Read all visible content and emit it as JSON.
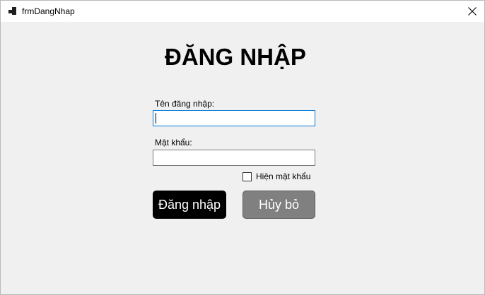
{
  "window": {
    "title": "frmDangNhap",
    "close_icon": "close-icon",
    "app_icon": "form-icon"
  },
  "form": {
    "heading": "ĐĂNG NHẬP",
    "username_label": "Tên đăng nhập:",
    "username_value": "",
    "password_label": "Mật khẩu:",
    "password_value": "",
    "show_password_label": "Hiện mật khẩu",
    "show_password_checked": false,
    "login_button": "Đăng nhập",
    "cancel_button": "Hủy bỏ"
  },
  "colors": {
    "login_button_bg": "#000000",
    "cancel_button_bg": "#808080",
    "focus_border": "#0078d7",
    "window_bg": "#f0f0f0"
  }
}
